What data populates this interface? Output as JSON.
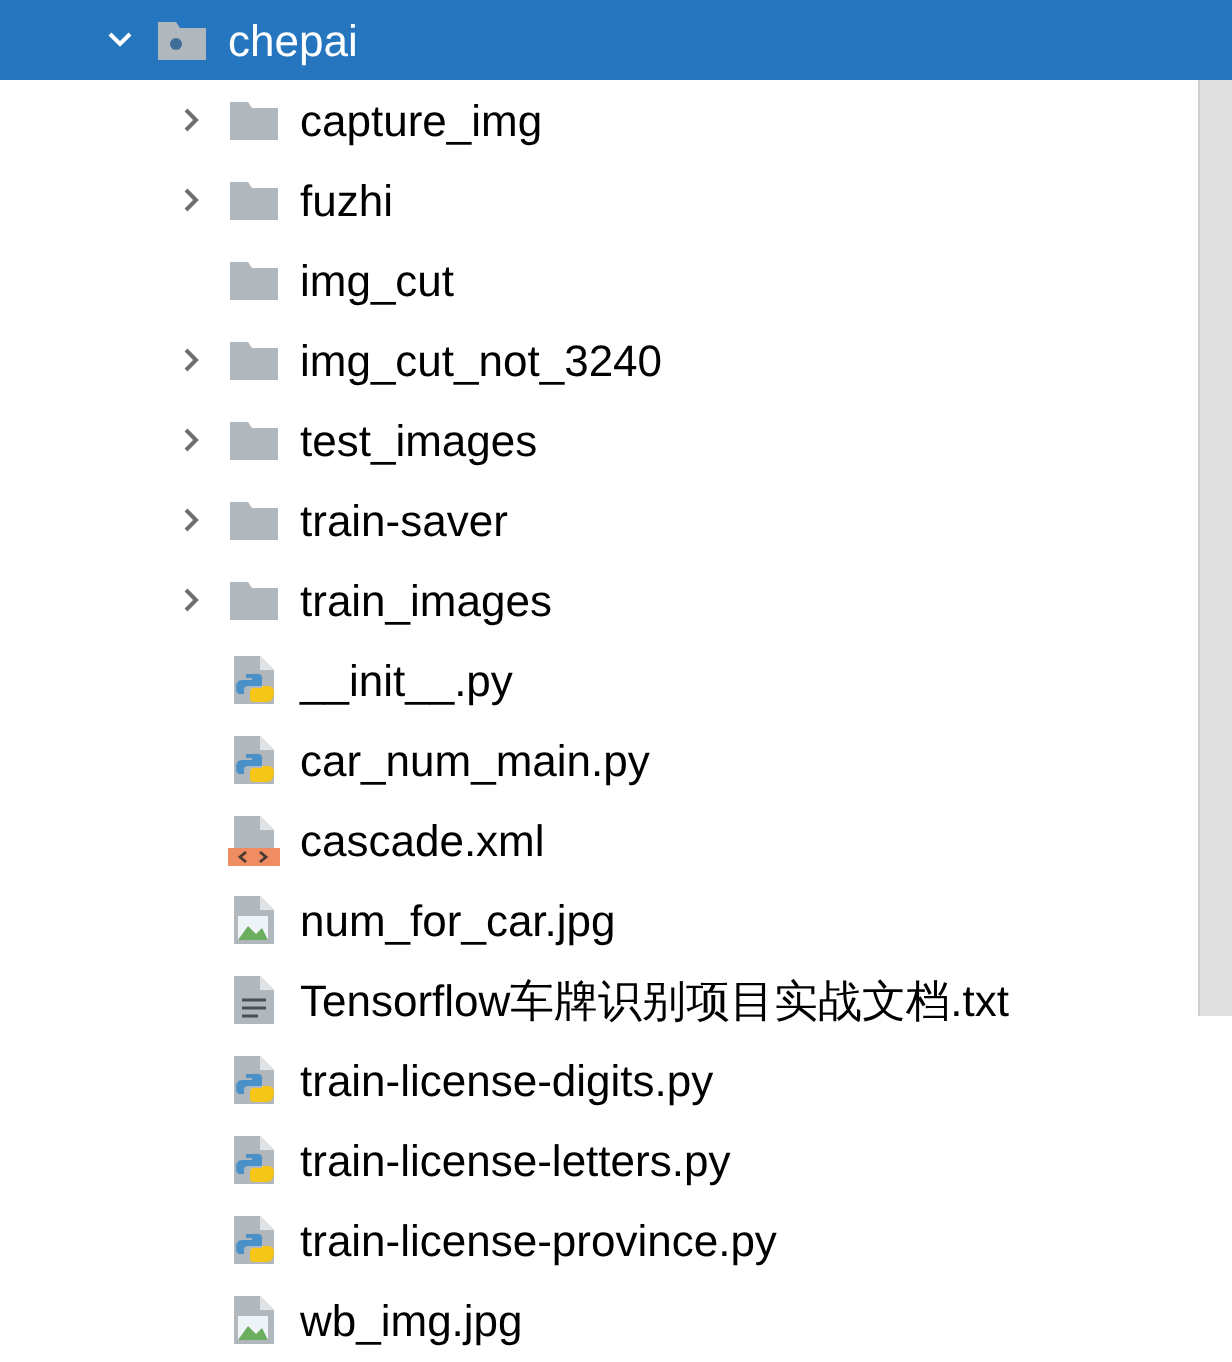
{
  "tree": {
    "name": "chepai",
    "kind": "module",
    "expanded": true,
    "selected": true,
    "children": [
      {
        "name": "capture_img",
        "kind": "folder",
        "expandable": true,
        "expanded": false,
        "selected": false
      },
      {
        "name": "fuzhi",
        "kind": "folder",
        "expandable": true,
        "expanded": false,
        "selected": false
      },
      {
        "name": "img_cut",
        "kind": "folder",
        "expandable": false,
        "selected": false
      },
      {
        "name": "img_cut_not_3240",
        "kind": "folder",
        "expandable": true,
        "expanded": false,
        "selected": false
      },
      {
        "name": "test_images",
        "kind": "folder",
        "expandable": true,
        "expanded": false,
        "selected": false
      },
      {
        "name": "train-saver",
        "kind": "folder",
        "expandable": true,
        "expanded": false,
        "selected": false
      },
      {
        "name": "train_images",
        "kind": "folder",
        "expandable": true,
        "expanded": false,
        "selected": false
      },
      {
        "name": "__init__.py",
        "kind": "python",
        "selected": false
      },
      {
        "name": "car_num_main.py",
        "kind": "python",
        "selected": false
      },
      {
        "name": "cascade.xml",
        "kind": "xml",
        "selected": false
      },
      {
        "name": "num_for_car.jpg",
        "kind": "image",
        "selected": false
      },
      {
        "name": "Tensorflow车牌识别项目实战文档.txt",
        "kind": "text",
        "selected": false
      },
      {
        "name": "train-license-digits.py",
        "kind": "python",
        "selected": false
      },
      {
        "name": "train-license-letters.py",
        "kind": "python",
        "selected": false
      },
      {
        "name": "train-license-province.py",
        "kind": "python",
        "selected": false
      },
      {
        "name": "wb_img.jpg",
        "kind": "image",
        "selected": false
      }
    ]
  }
}
